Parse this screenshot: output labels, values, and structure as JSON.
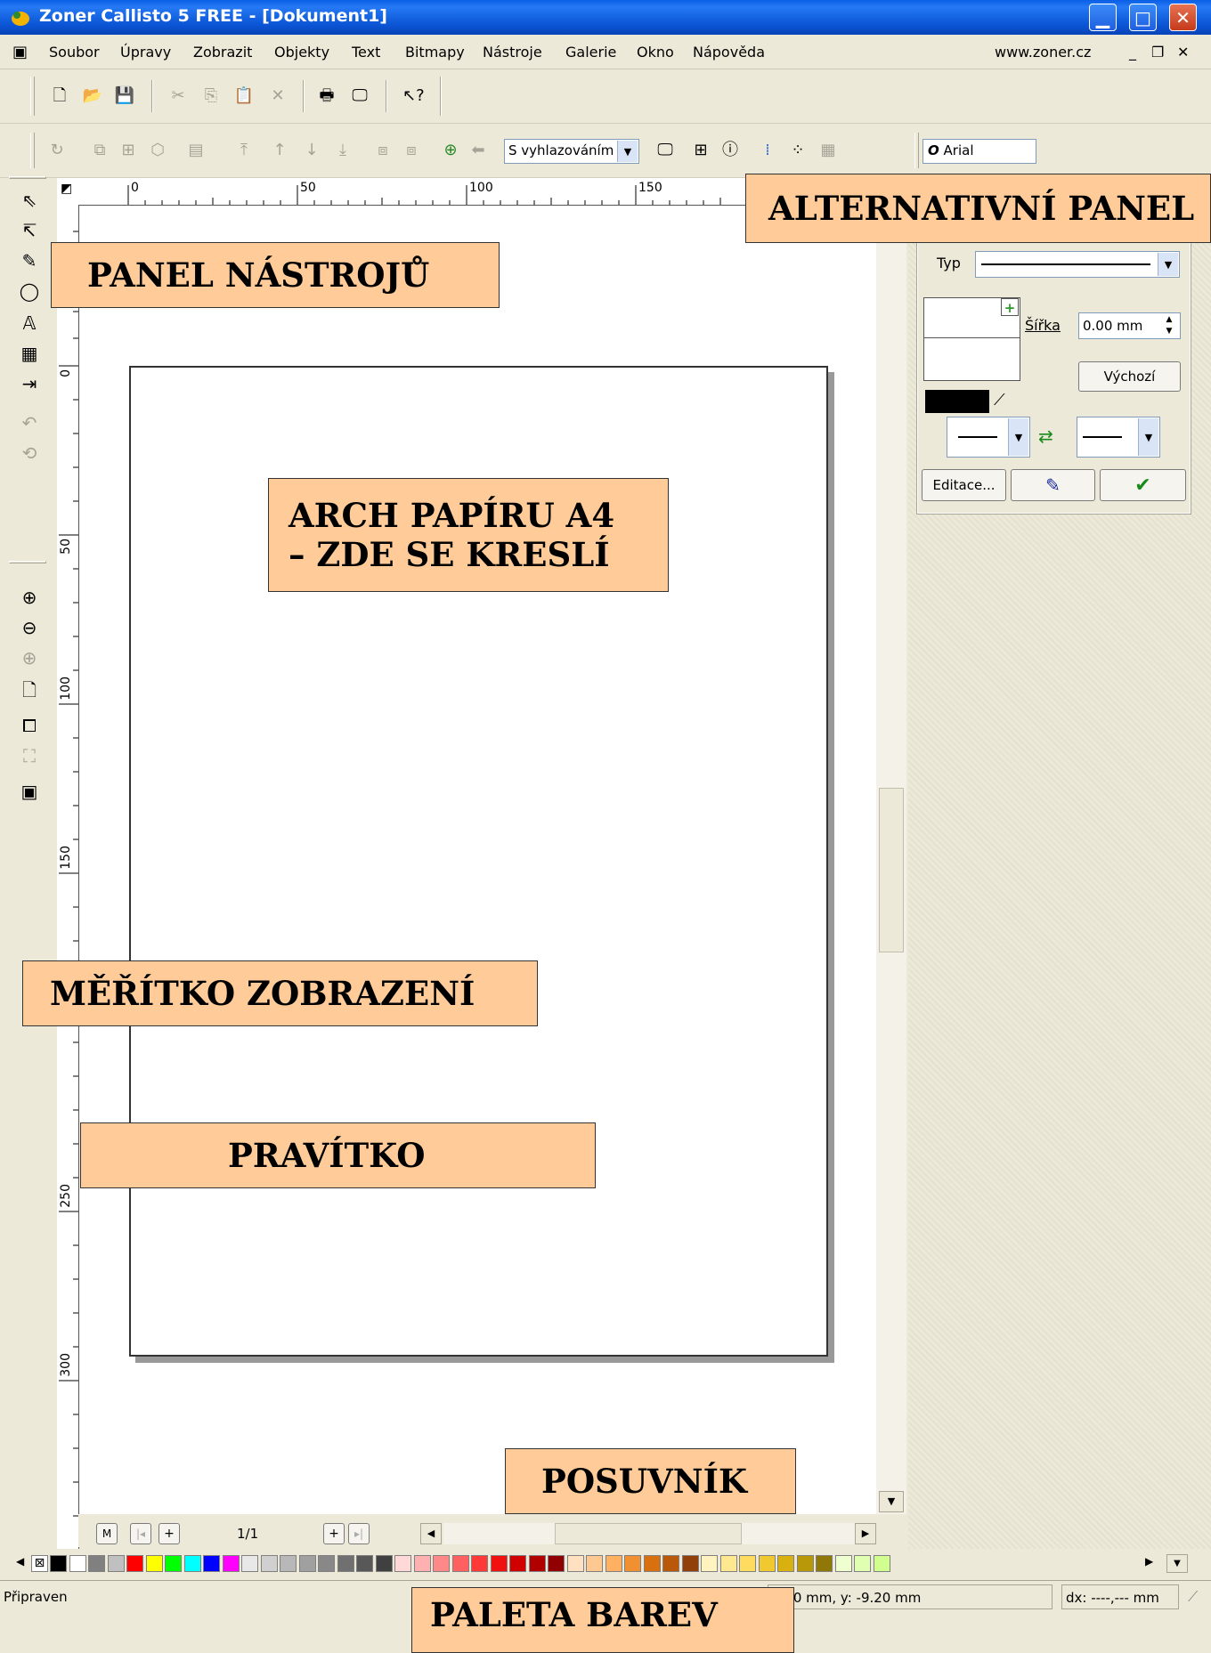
{
  "window": {
    "title": "Zoner Callisto 5 FREE - [Dokument1]"
  },
  "menu": {
    "items": [
      "Soubor",
      "Úpravy",
      "Zobrazit",
      "Objekty",
      "Text",
      "Bitmapy",
      "Nástroje",
      "Galerie",
      "Okno",
      "Nápověda"
    ],
    "website": "www.zoner.cz"
  },
  "toolbar2": {
    "smoothing_combo": "S vyhlazováním",
    "font_combo": "Arial"
  },
  "rulers": {
    "horizontal": [
      "0",
      "50",
      "100",
      "150"
    ],
    "vertical": [
      "0",
      "50",
      "100",
      "150",
      "250",
      "300"
    ]
  },
  "line_panel": {
    "type_label": "Typ",
    "width_label": "Šířka",
    "width_value": "0.00 mm",
    "default_button": "Výchozí",
    "edit_button": "Editace..."
  },
  "page_nav": {
    "first": "M",
    "indicator": "1/1"
  },
  "status": {
    "ready": "Připraven",
    "coords": "3.60 mm, y: -9.20 mm",
    "delta": "dx: ----,--- mm"
  },
  "callouts": {
    "alt_panel": "ALTERNATIVNÍ PANEL",
    "tools_panel": "PANEL NÁSTROJŮ",
    "paper_line1": "ARCH PAPÍRU A4",
    "paper_line2": "– ZDE SE KRESLÍ",
    "zoom": "MĚŘÍTKO ZOBRAZENÍ",
    "ruler": "PRAVÍTKO",
    "scrollbar": "POSUVNÍK",
    "palette": "PALETA BAREV"
  },
  "colors": {
    "callout_bg": "#FFCC99",
    "titlebar": "#0A5FE6",
    "palette": [
      "#000000",
      "#FFFFFF",
      "#808080",
      "#C0C0C0",
      "#FF0000",
      "#FFFF00",
      "#00FF00",
      "#00FFFF",
      "#0000FF",
      "#FF00FF",
      "#E8E8E8",
      "#D0D0D0",
      "#B8B8B8",
      "#A0A0A0",
      "#888888",
      "#707070",
      "#585858",
      "#404040",
      "#FFD8D8",
      "#FFB0B0",
      "#FF8888",
      "#FF6060",
      "#FF3838",
      "#F01010",
      "#D00000",
      "#B00000",
      "#900000",
      "#FFE0C0",
      "#FFC890",
      "#FFB060",
      "#F09030",
      "#D87010",
      "#B85808",
      "#904008",
      "#FFF4C0",
      "#FFE890",
      "#FFDC60",
      "#F0C830",
      "#D8B010",
      "#B89808",
      "#907808",
      "#F0FFD0",
      "#E0FFB0",
      "#D0FF90"
    ]
  }
}
